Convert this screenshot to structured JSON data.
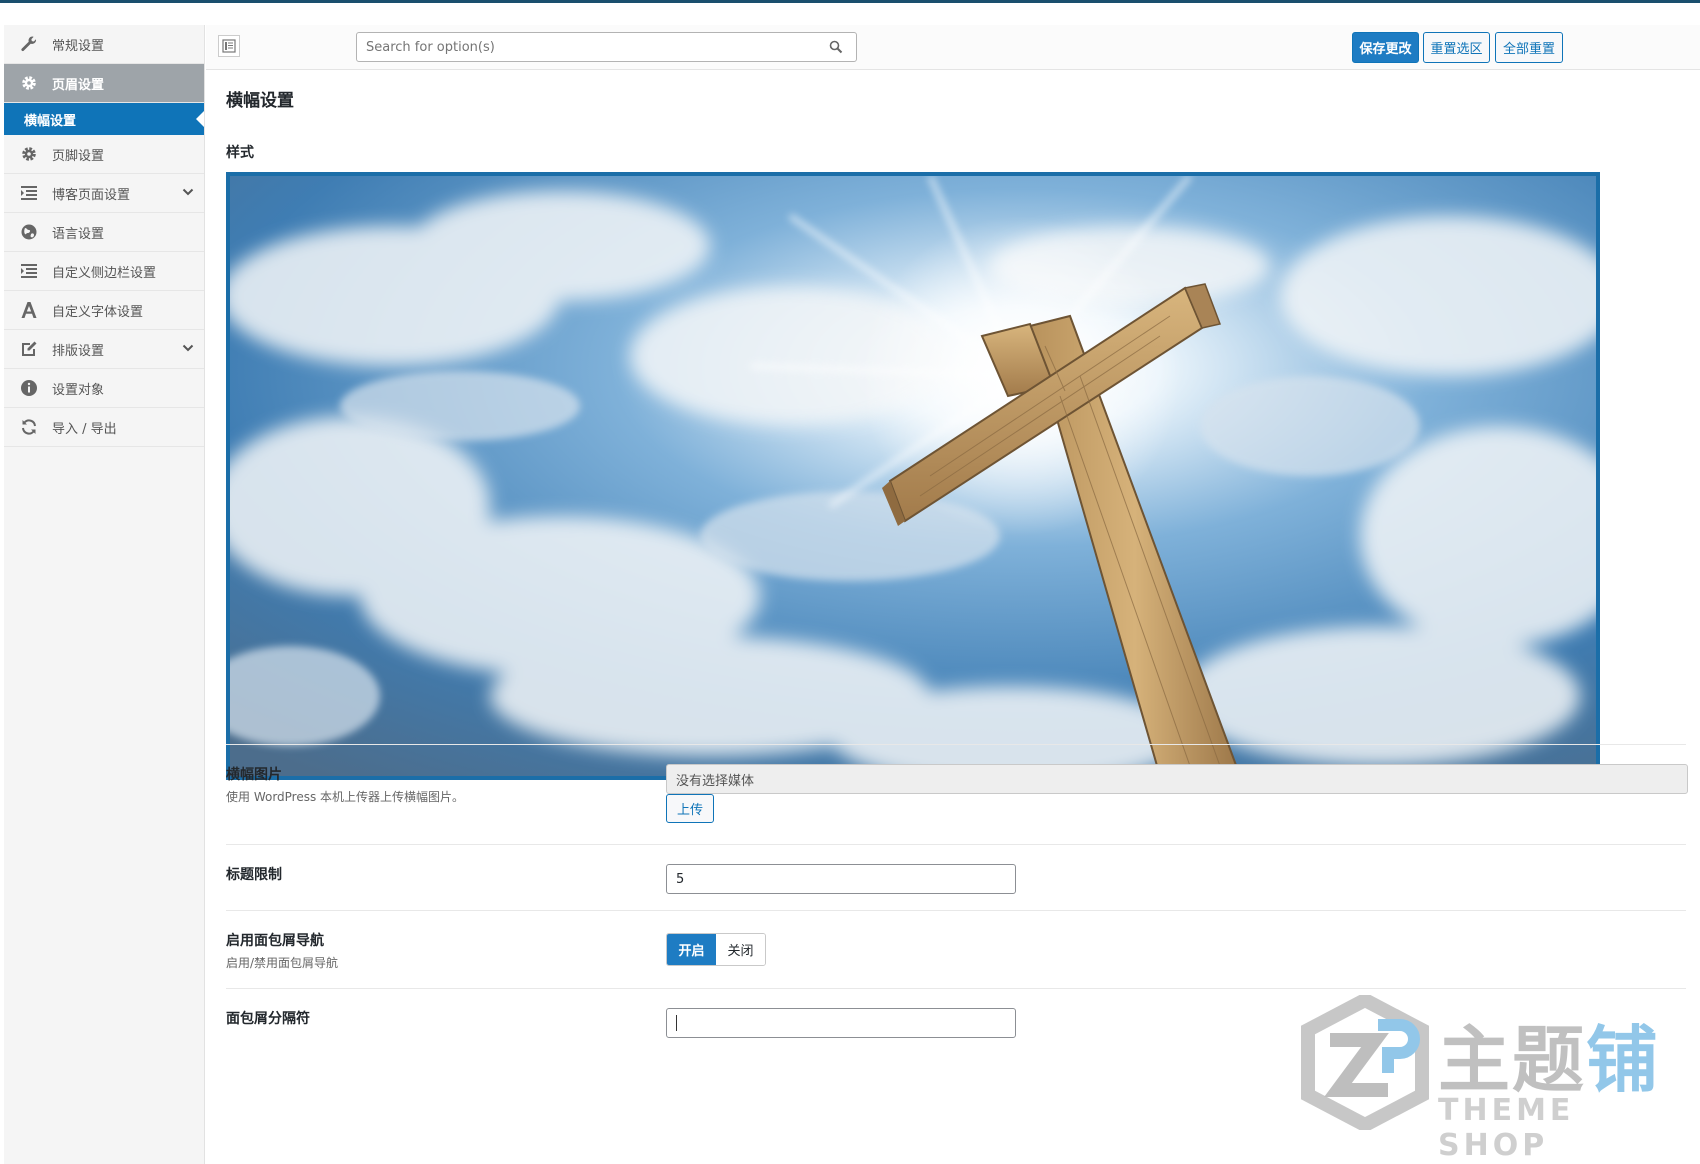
{
  "sidebar": {
    "items": [
      {
        "label": "常规设置",
        "icon": "wrench-icon"
      },
      {
        "label": "页眉设置",
        "icon": "gear-icon",
        "active": true
      },
      {
        "label": "页脚设置",
        "icon": "gear-icon"
      },
      {
        "label": "博客页面设置",
        "icon": "list-icon",
        "expandable": true
      },
      {
        "label": "语言设置",
        "icon": "globe-icon"
      },
      {
        "label": "自定义侧边栏设置",
        "icon": "list-icon"
      },
      {
        "label": "自定义字体设置",
        "icon": "font-icon"
      },
      {
        "label": "排版设置",
        "icon": "edit-icon",
        "expandable": true
      },
      {
        "label": "设置对象",
        "icon": "info-icon"
      },
      {
        "label": "导入 / 导出",
        "icon": "refresh-icon"
      }
    ],
    "active_sub": "横幅设置"
  },
  "header": {
    "search_placeholder": "Search for option(s)",
    "save_label": "保存更改",
    "reset_section_label": "重置选区",
    "reset_all_label": "全部重置",
    "accent_color": "#1e7cc3"
  },
  "main": {
    "page_title": "横幅设置",
    "style_label": "样式",
    "preview_image": "cross-against-cloudy-sky",
    "fields": {
      "banner_image": {
        "title": "横幅图片",
        "desc": "使用 WordPress 本机上传器上传横幅图片。",
        "value": "没有选择媒体",
        "upload_label": "上传"
      },
      "title_limit": {
        "title": "标题限制",
        "value": "5"
      },
      "breadcrumb_nav": {
        "title": "启用面包屑导航",
        "desc": "启用/禁用面包屑导航",
        "on_label": "开启",
        "off_label": "关闭",
        "state": "on"
      },
      "breadcrumb_separator": {
        "title": "面包屑分隔符",
        "value": ""
      }
    }
  },
  "watermark": {
    "cn_gray": "主题",
    "cn_blue": "铺",
    "en": "THEME SHOP"
  }
}
